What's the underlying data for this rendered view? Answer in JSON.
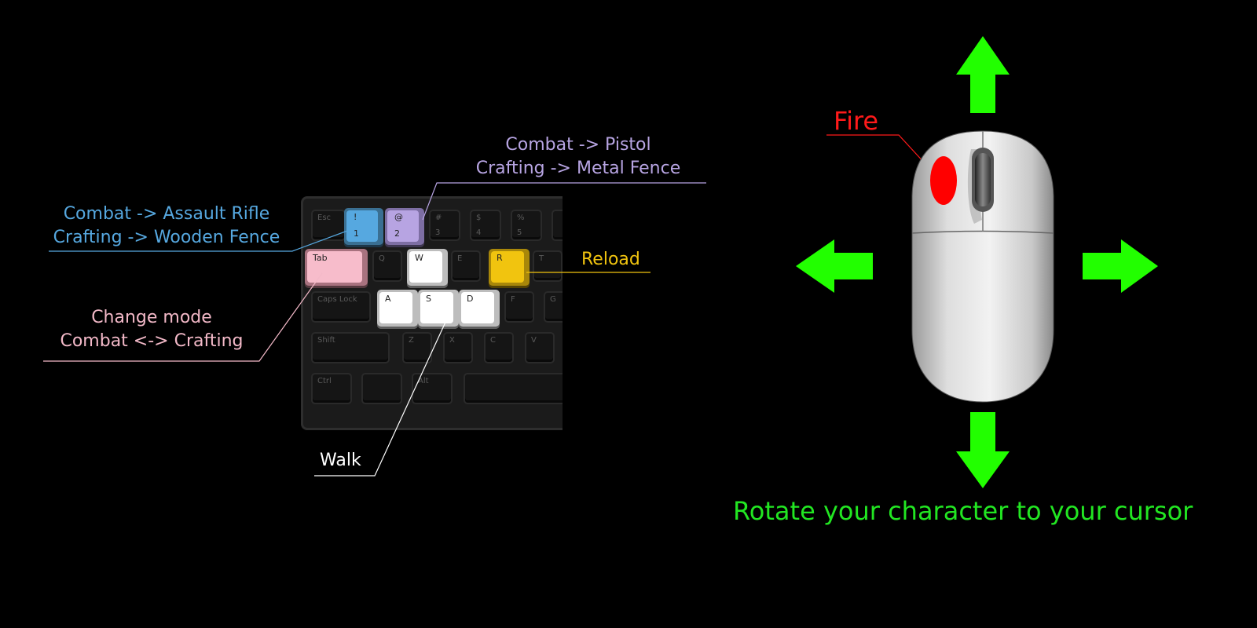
{
  "colors": {
    "blue": "#56a8e0",
    "purple": "#b7a4e2",
    "pink": "#f3b9c8",
    "yellow": "#f1c40f",
    "white": "#ffffff",
    "red": "#ff1a1a",
    "green": "#22ff00"
  },
  "annotations": {
    "key1": {
      "line1": "Combat -> Assault Rifle",
      "line2": "Crafting -> Wooden Fence"
    },
    "key2": {
      "line1": "Combat -> Pistol",
      "line2": "Crafting -> Metal Fence"
    },
    "tab": {
      "line1": "Change mode",
      "line2": "Combat <-> Crafting"
    },
    "reload": "Reload",
    "walk": "Walk",
    "fire": "Fire",
    "mouse_move": "Rotate your character to your cursor"
  },
  "keyboard": {
    "esc": "Esc",
    "num1": {
      "top": "!",
      "bottom": "1"
    },
    "num2": {
      "top": "@",
      "bottom": "2"
    },
    "num3": {
      "top": "#",
      "bottom": "3"
    },
    "num4": {
      "top": "$",
      "bottom": "4"
    },
    "num5": {
      "top": "%",
      "bottom": "5"
    },
    "tab": "Tab",
    "q": "Q",
    "w": "W",
    "e": "E",
    "r": "R",
    "t": "T",
    "caps": "Caps Lock",
    "a": "A",
    "s": "S",
    "d": "D",
    "f": "F",
    "g": "G",
    "shift": "Shift",
    "z": "Z",
    "x": "X",
    "c": "C",
    "v": "V",
    "ctrl": "Ctrl",
    "alt": "Alt"
  },
  "icons": [
    "arrow-up-icon",
    "arrow-down-icon",
    "arrow-left-icon",
    "arrow-right-icon",
    "mouse-icon"
  ]
}
